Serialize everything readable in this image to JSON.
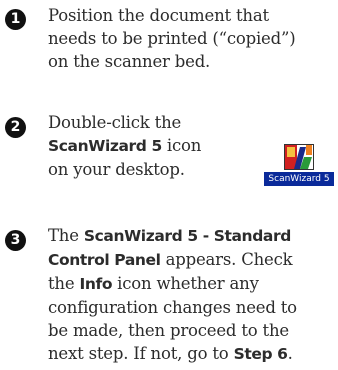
{
  "steps": [
    {
      "number": "1",
      "lines": [
        "Position the document that",
        "needs to be printed (“copied”)",
        "on the scanner bed."
      ]
    },
    {
      "number": "2",
      "line1": "Double-click the",
      "line2_bold": "ScanWizard 5",
      "line2_rest": " icon",
      "line3": "on your desktop."
    },
    {
      "number": "3",
      "l1_pre": "The ",
      "l1_bold": "ScanWizard 5 - Standard",
      "l2_bold": "Control Panel",
      "l2_rest": " appears. Check",
      "l3_pre": "the ",
      "l3_bold": "Info",
      "l3_rest": " icon whether any",
      "l4": "configuration changes need to",
      "l5": "be made, then proceed to the",
      "l6_pre": "next step. If not, go to ",
      "l6_bold": "Step 6",
      "l6_post": "."
    }
  ],
  "desktop_icon": {
    "label": "ScanWizard 5",
    "icon_name": "scanwizard-app-icon"
  }
}
